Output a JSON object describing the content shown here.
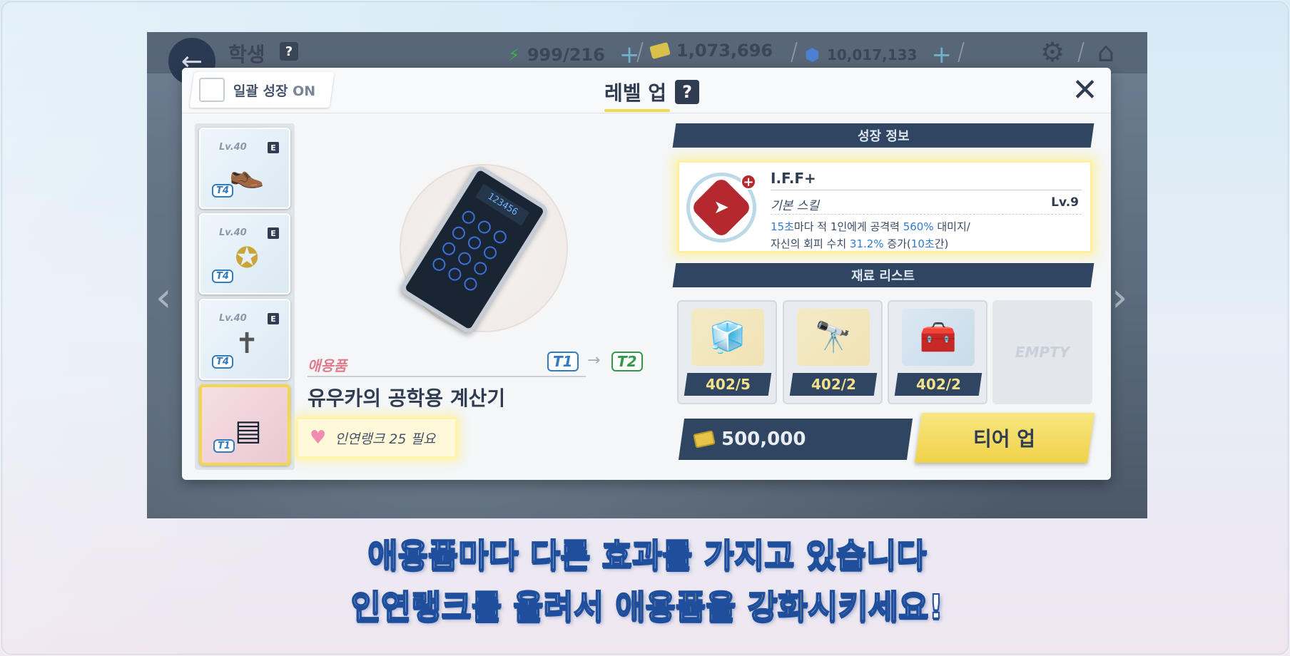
{
  "top_bar": {
    "back_icon": "back-arrow-icon",
    "title": "학생",
    "help": "?",
    "ap": "999/216",
    "credits": "1,073,696",
    "gems": "10,017,133"
  },
  "modal": {
    "bulk_growth_label": "일괄 성장",
    "bulk_growth_state": "ON",
    "title": "레벨 업",
    "help": "?",
    "close": "✕"
  },
  "item_list": [
    {
      "level": "Lv.40",
      "grade": "E",
      "tier": "T4",
      "icon": "shoes-icon"
    },
    {
      "level": "Lv.40",
      "grade": "E",
      "tier": "T4",
      "icon": "badge-icon"
    },
    {
      "level": "Lv.40",
      "grade": "E",
      "tier": "T4",
      "icon": "cross-necklace-icon"
    },
    {
      "tier": "T1",
      "icon": "calculator-icon",
      "selected": true
    }
  ],
  "item_detail": {
    "category": "애용품",
    "tier_from": "T1",
    "tier_to": "T2",
    "name": "유우카의 공학용 계산기",
    "calc_display": "123456",
    "requirement": "인연랭크 25 필요"
  },
  "growth_info": {
    "header": "성장 정보",
    "skill_name": "I.F.F+",
    "skill_type": "기본 스킬",
    "skill_level": "Lv.9",
    "desc_line1": {
      "a": "15초",
      "b": "마다 적 1인에게 공격력 ",
      "c": "560%",
      "d": " 대미지/"
    },
    "desc_line2": {
      "a": "자신의 회피 수치 ",
      "b": "31.2%",
      "c": " 증가(",
      "d": "10초",
      "e": "간)"
    }
  },
  "materials": {
    "header": "재료 리스트",
    "items": [
      {
        "count": "402/5",
        "icon": "cube-icon"
      },
      {
        "count": "402/2",
        "icon": "telescope-icon"
      },
      {
        "count": "402/2",
        "icon": "toolbox-icon"
      }
    ],
    "empty_label": "EMPTY"
  },
  "cost": "500,000",
  "tier_up_button": "티어 업",
  "caption": {
    "line1": "애용품마다 다른 효과를 가지고 있습니다",
    "line2_a": "인연랭크를 올려서 ",
    "line2_b": "애용품을 강화",
    "line2_c": "시키세요!"
  }
}
